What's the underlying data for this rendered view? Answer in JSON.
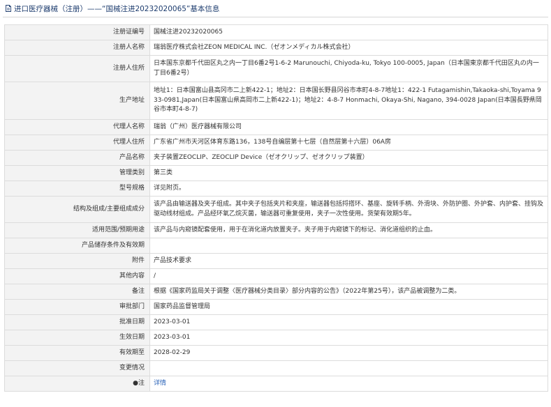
{
  "header": {
    "title": "进口医疗器械（注册）——“国械注进20232020065”基本信息"
  },
  "rows": [
    {
      "label": "注册证编号",
      "value": "国械注进20232020065"
    },
    {
      "label": "注册人名称",
      "value": "瑞翁医疗株式会社ZEON MEDICAL INC.（ゼオンメディカル株式会社）"
    },
    {
      "label": "注册人住所",
      "value": "日本国东京都千代田区丸之内一丁目6番2号1-6-2 Marunouchi, Chiyoda-ku, Tokyo 100-0005, Japan（日本国東京都千代田区丸の内一丁目6番2号）"
    },
    {
      "label": "生产地址",
      "value": "地址1：日本国富山县高冈市二上新422-1；地址2：日本国长野县冈谷市本町4-8-7地址1：422-1 Futagamishin,Takaoka-shi,Toyama 933-0981,Japan(日本国富山県高岡市二上新422-1)；地址2：4-8-7 Honmachi, Okaya-Shi, Nagano, 394-0028 Japan(日本国長野県岡谷市本町4-8-7)"
    },
    {
      "label": "代理人名称",
      "value": "瑞翁（广州）医疗器械有限公司"
    },
    {
      "label": "代理人住所",
      "value": "广东省广州市天河区体育东路136，138号自编层第十七层（自然层第十六层）06A房"
    },
    {
      "label": "产品名称",
      "value": "夹子装置ZEOCLIP、ZEOCLIP Device（ゼオクリップ、ゼオクリップ装置）"
    },
    {
      "label": "管理类别",
      "value": "第三类"
    },
    {
      "label": "型号规格",
      "value": "详见附页。"
    },
    {
      "label": "结构及组成/主要组成成分",
      "value": "该产品由输送器及夹子组成。其中夹子包括夹片和夹座，输送器包括捋搭环、基座、旋转手柄、外滑块、外防护圈、外护套、内护套、挂钩及驱动线材组成。产品经环氧乙烷灭菌，输送器可重复使用，夹子一次性使用。货架有效期5年。"
    },
    {
      "label": "适用范围/预期用途",
      "value": "该产品与内窥镜配套使用，用于在消化道内放置夹子。夹子用于内窥镜下的标记、消化道组织的止血。"
    },
    {
      "label": "产品储存条件及有效期",
      "value": ""
    },
    {
      "label": "附件",
      "value": "产品技术要求"
    },
    {
      "label": "其他内容",
      "value": "/"
    },
    {
      "label": "备注",
      "value": "根据《国家药监局关于调整〈医疗器械分类目录〉部分内容的公告》（2022年第25号），该产品被调整为二类。"
    },
    {
      "label": "审批部门",
      "value": "国家药品监督管理局"
    },
    {
      "label": "批准日期",
      "value": "2023-03-01"
    },
    {
      "label": "生效日期",
      "value": "2023-03-01"
    },
    {
      "label": "有效期至",
      "value": "2028-02-29"
    },
    {
      "label": "变更情况",
      "value": ""
    }
  ],
  "note_row": {
    "label": "●注",
    "link": "详情"
  },
  "colors": {
    "header_text": "#1d3c6e",
    "label_bg": "#f3f3f3",
    "border": "#dcdcdc",
    "link": "#2a63b8"
  }
}
